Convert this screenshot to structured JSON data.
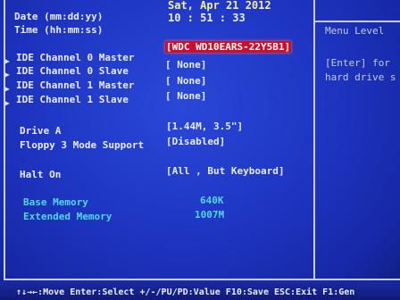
{
  "header": {
    "date_label": "Date (mm:dd:yy)",
    "time_label": "Time (hh:mm:ss)",
    "date_value": "Sat, Apr 21 2012",
    "time_value": "10 : 51 : 33"
  },
  "items": [
    {
      "label": "IDE Channel 0 Master",
      "value": "[WDC WD10EARS-22Y5B1]"
    },
    {
      "label": "IDE Channel 0 Slave",
      "value": "[ None]"
    },
    {
      "label": "IDE Channel 1 Master",
      "value": "[ None]"
    },
    {
      "label": "IDE Channel 1 Slave",
      "value": "[ None]"
    },
    {
      "label": "Drive A",
      "value": "[1.44M, 3.5\"]"
    },
    {
      "label": "Floppy 3 Mode Support",
      "value": "[Disabled]"
    },
    {
      "label": "Halt On",
      "value": "[All , But Keyboard]"
    }
  ],
  "memory": {
    "base_label": "Base Memory",
    "base_value": "640K",
    "ext_label": "Extended Memory",
    "ext_value": "1007M"
  },
  "help": {
    "title": "Menu Level",
    "line1": "[Enter] for",
    "line2": "hard drive s"
  },
  "footer": {
    "text": "↑↓→←:Move  Enter:Select  +/-/PU/PD:Value  F10:Save  ESC:Exit  F1:Gen"
  },
  "colors": {
    "background": "#1f36c4",
    "highlight": "#c8102e",
    "label": "#e9ecf8",
    "value": "#f2ef8c",
    "memory": "#4fd7f0"
  }
}
